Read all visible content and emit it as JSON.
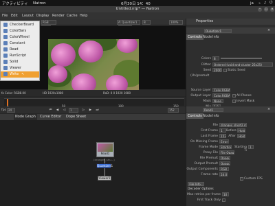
{
  "system_bar": {
    "activities": "アクティビティ",
    "app": "Natron",
    "clock": "6月30日 14：40",
    "lang": "ja"
  },
  "window": {
    "title": "Untitled.ntp* — Natron"
  },
  "menubar": [
    "File",
    "Edit",
    "Layout",
    "Display",
    "Render",
    "Cache",
    "Help"
  ],
  "create_menu": {
    "items": [
      "CheckerBoard",
      "ColorBars",
      "ColorWheel",
      "Constant",
      "Read",
      "RunScript",
      "Solid",
      "Viewer",
      "Write"
    ],
    "selected": "Write"
  },
  "viewer": {
    "layer": "RGB",
    "node_select": "A: Quantizer1",
    "gain": "+0.0",
    "colorspace": "sRGB",
    "resolution_left": "1.0",
    "info_left": "fo Color: RGB8.00",
    "format_left": "HD 1920x1080",
    "format_right": "RoD: 0 0 1920 1080",
    "fps": "fps",
    "fps_value": "24",
    "frame": "1",
    "end_frame": "152",
    "ticks": [
      "1",
      "50",
      "100",
      "150"
    ]
  },
  "node_graph": {
    "tabs": [
      "Node Graph",
      "Curve Editor",
      "Dope Sheet"
    ],
    "active_tab": "Node Graph",
    "nodes": [
      {
        "name": "Read1",
        "sub": "(dranges_shu...)"
      },
      {
        "name": "Quantizer1"
      },
      {
        "name": "Viewer1"
      }
    ]
  },
  "properties": {
    "title": "Properties",
    "quantizer": {
      "node_name": "Quantizer1",
      "tabs": [
        "Controls",
        "Node",
        "Info"
      ],
      "colors_label": "Colors",
      "colors_value": "8",
      "dither_label": "Dither",
      "dither_value": "Ordered (void-and-cluster 25x25)",
      "seed_label": "Seed",
      "seed_value": "2000",
      "static_seed_label": "Static Seed",
      "unpremult": "(Un)premult",
      "source_layer_label": "Source Layer",
      "source_layer_value": "Color.RGBA",
      "output_layer_label": "Output Layer",
      "output_layer_value": "Color.RGBA",
      "all_planes_label": "All Planes",
      "mask_label": "Mask",
      "mask_value": "None",
      "invert_mask_label": "Invert Mask",
      "mix_label": "Mix",
      "mix_value": "1.0"
    },
    "read": {
      "node_name": "Read1",
      "tabs": [
        "Controls",
        "Node",
        "Info"
      ],
      "file_label": "File",
      "file_value": "dranges_short2.mp4",
      "first_frame_label": "First Frame",
      "first_frame_value": "1",
      "before_label": "Before",
      "before_value": "Hold",
      "last_frame_label": "Last Frame",
      "last_frame_value": "152",
      "after_label": "After",
      "after_value": "Hold",
      "on_missing_label": "On Missing Frame",
      "on_missing_value": "Error",
      "frame_mode_label": "Frame Mode",
      "frame_mode_value": "Starting",
      "starting_frame_label": "Starting Ti",
      "starting_frame_value": "1",
      "proxy_label": "Proxy File",
      "proxy_value": "File Opaque",
      "file_premult_label": "File Premult",
      "file_premult_value": "Opaque",
      "output_premult_label": "Output Premult",
      "output_premult_value": "Opaque",
      "output_components_label": "Output Components",
      "output_components_value": "RGB",
      "frame_rate_label": "Frame rate",
      "frame_rate_value": "24.0",
      "custom_fps_label": "Custom FPS",
      "file_info_button": "File Info...",
      "decoder_options": "Decoder Options",
      "max_retries_label": "Max retries per frame",
      "max_retries_value": "10",
      "first_track_label": "First Track Only"
    }
  }
}
